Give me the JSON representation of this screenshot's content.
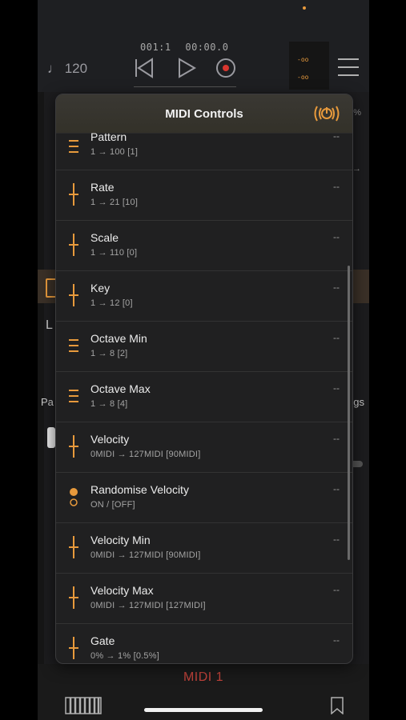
{
  "header": {
    "tempo": "♩ 120",
    "bar_position": "001:1",
    "time_position": "00:00.0",
    "meter_top": "-oo",
    "meter_bottom": "-oo"
  },
  "background": {
    "partial_left": "L",
    "partial_pa": "Pa",
    "partial_gs": "gs",
    "partial_right_a": "%",
    "partial_right_b": "→"
  },
  "panel": {
    "title": "MIDI Controls",
    "rows": [
      {
        "name": "Pattern",
        "range": "1 → 100 [1]",
        "value": "--",
        "icon": "list-icon"
      },
      {
        "name": "Rate",
        "range": "1 → 21  [10]",
        "value": "--",
        "icon": "slider-icon"
      },
      {
        "name": "Scale",
        "range": "1 → 110  [0]",
        "value": "--",
        "icon": "slider-icon"
      },
      {
        "name": "Key",
        "range": "1 → 12  [0]",
        "value": "--",
        "icon": "slider-icon"
      },
      {
        "name": "Octave Min",
        "range": "1 → 8 [2]",
        "value": "--",
        "icon": "list-icon"
      },
      {
        "name": "Octave Max",
        "range": "1 → 8 [4]",
        "value": "--",
        "icon": "list-icon"
      },
      {
        "name": "Velocity",
        "range": "0MIDI → 127MIDI  [90MIDI]",
        "value": "--",
        "icon": "slider-icon"
      },
      {
        "name": "Randomise Velocity",
        "range": "ON / [OFF]",
        "value": "--",
        "icon": "toggle-icon"
      },
      {
        "name": "Velocity Min",
        "range": "0MIDI → 127MIDI  [90MIDI]",
        "value": "--",
        "icon": "slider-icon"
      },
      {
        "name": "Velocity Max",
        "range": "0MIDI → 127MIDI  [127MIDI]",
        "value": "--",
        "icon": "slider-icon"
      },
      {
        "name": "Gate",
        "range": "0% → 1%  [0.5%]",
        "value": "--",
        "icon": "slider-icon"
      }
    ]
  },
  "footer": {
    "label": "MIDI 1"
  },
  "colors": {
    "accent": "#e89a3c",
    "record": "#d8362f",
    "footer_label": "#c0423a"
  }
}
